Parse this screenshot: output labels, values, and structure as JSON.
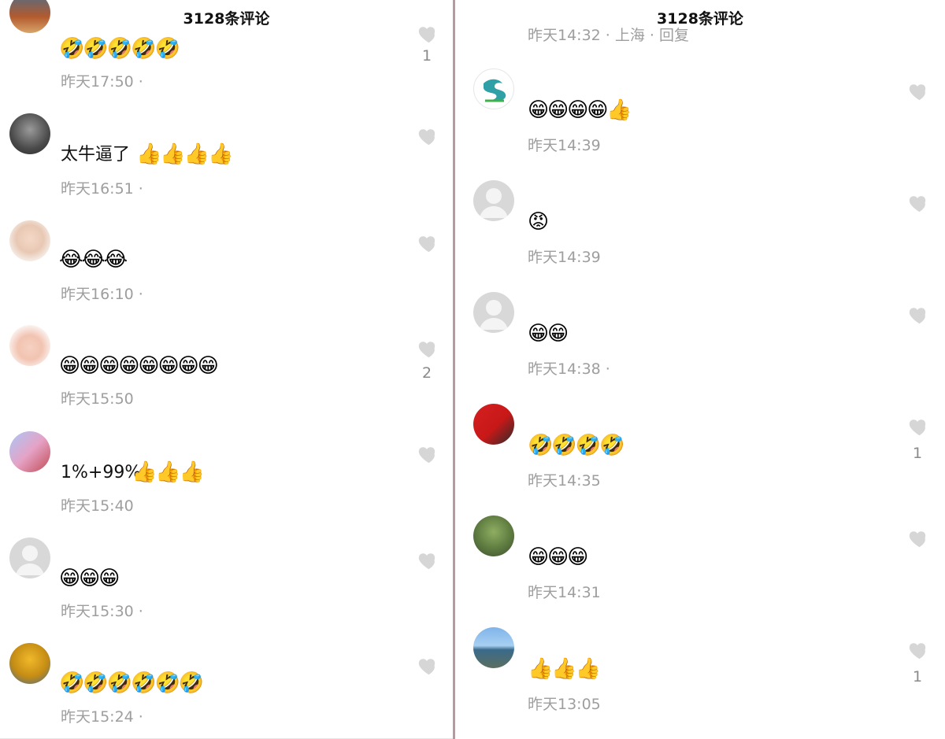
{
  "left": {
    "title": "3128条评论",
    "comments": [
      {
        "emojis": "🤣🤣🤣🤣🤣",
        "time": "昨天17:50 ·",
        "likes": "1"
      },
      {
        "text": "太牛逼了",
        "emojis": "👍👍👍👍",
        "time": "昨天16:51 ·",
        "likes": ""
      },
      {
        "emojis": "😂😂😂",
        "time": "昨天16:10 ·",
        "likes": ""
      },
      {
        "emojis": "😁😁😁😁😁😁😁😁",
        "time": "昨天15:50",
        "likes": "2"
      },
      {
        "text": "1%+99%",
        "emojis": "👍👍👍",
        "time": "昨天15:40",
        "likes": ""
      },
      {
        "emojis": "😁😁😁",
        "time": "昨天15:30 ·",
        "likes": ""
      },
      {
        "emojis": "🤣🤣🤣🤣🤣🤣",
        "time": "昨天15:24 ·",
        "likes": ""
      }
    ]
  },
  "right": {
    "title": "3128条评论",
    "top_cut_time": "昨天14:32 · 上海 · 回复",
    "comments": [
      {
        "emojis": "😁😁😁😁👍",
        "time": "昨天14:39",
        "likes": ""
      },
      {
        "emojis": "😡",
        "time": "昨天14:39",
        "likes": ""
      },
      {
        "emojis": "😁😁",
        "time": "昨天14:38 ·",
        "likes": ""
      },
      {
        "emojis": "🤣🤣🤣🤣",
        "time": "昨天14:35",
        "likes": "1"
      },
      {
        "emojis": "😁😁😁",
        "time": "昨天14:31",
        "likes": ""
      },
      {
        "emojis": "👍👍👍",
        "time": "昨天13:05",
        "likes": "1"
      }
    ]
  },
  "icons": {
    "like": "heart-icon",
    "avatar_default": "default-avatar-icon"
  },
  "colors": {
    "time": "#9e9e9e",
    "heart": "#d6d6d6",
    "divider": "#b79aa0"
  }
}
